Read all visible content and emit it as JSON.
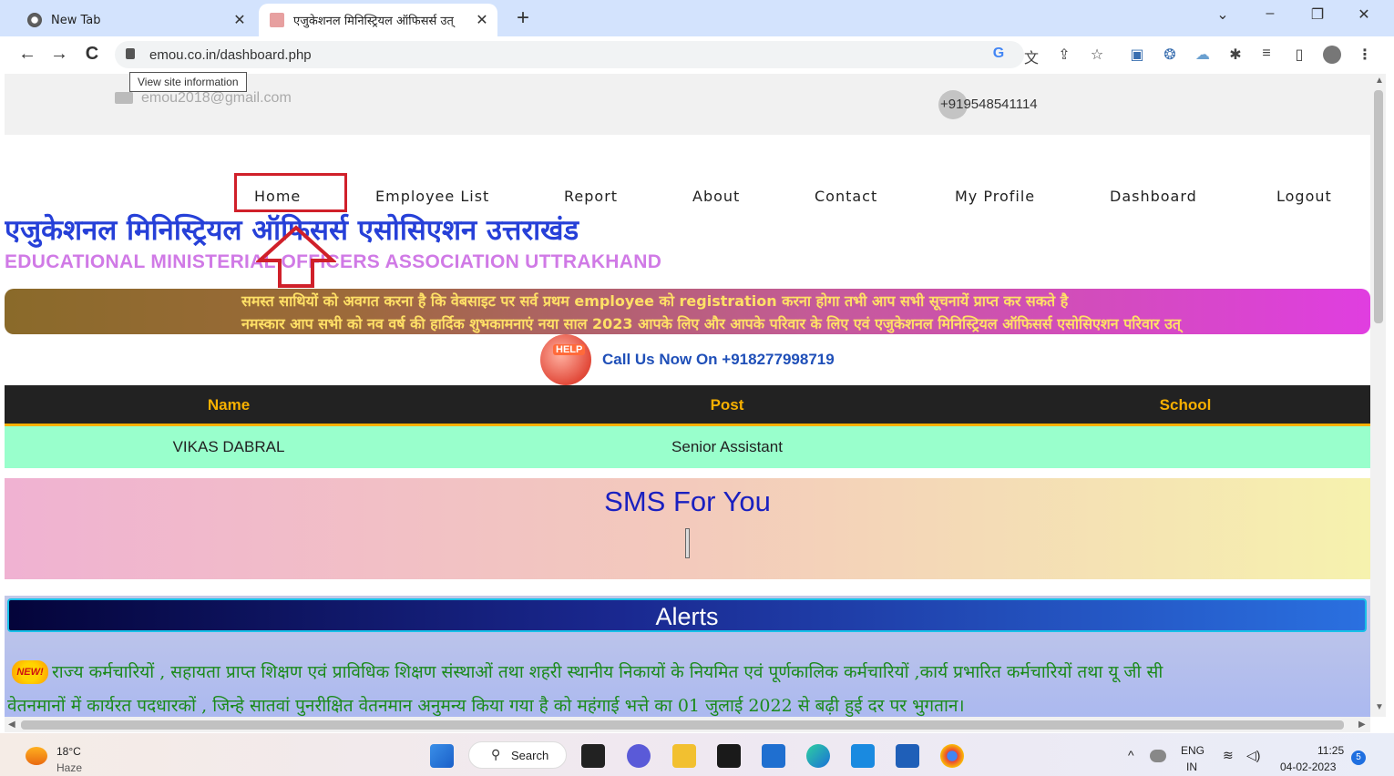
{
  "browser": {
    "tabs": [
      {
        "label": "New Tab",
        "active": false
      },
      {
        "label": "एजुकेशनल मिनिस्ट्रियल ऑफिसर्स उत्",
        "active": true
      }
    ],
    "new_tab": "+",
    "window_controls": {
      "dropdown": "⌄",
      "minimize": "–",
      "restore": "❐",
      "close": "✕"
    },
    "nav": {
      "back": "←",
      "forward": "→",
      "reload": "C"
    },
    "url": "emou.co.in/dashboard.php",
    "tooltip": "View site information",
    "toolbar_icons": [
      "google-icon",
      "translate-icon",
      "share-icon",
      "bookmark-star-icon",
      "extension-image-icon",
      "extension-feather-icon",
      "extension-cloud-icon",
      "extensions-puzzle-icon",
      "reading-list-icon",
      "side-panel-icon",
      "profile-avatar-icon",
      "menu-kebab-icon"
    ]
  },
  "site": {
    "email": "emou2018@gmail.com",
    "phone": "+919548541114",
    "nav": [
      "Home",
      "Employee List",
      "Report",
      "About",
      "Contact",
      "My Profile",
      "Dashboard",
      "Logout"
    ],
    "title_hindi": "एजुकेशनल मिनिस्ट्रियल ऑफिसर्स एसोसिएशन उत्तराखंड",
    "title_english": "EDUCATIONAL MINISTERIAL OFFICERS ASSOCIATION UTTRAKHAND",
    "marquee": [
      "समस्त साथियों को अवगत करना है कि वेबसाइट पर सर्व प्रथम employee को registration करना होगा तभी आप सभी सूचनायें प्राप्त कर सकते है",
      "नमस्कार आप सभी को नव वर्ष की हार्दिक शुभकामनाएं नया साल 2023 आपके लिए और आपके परिवार के लिए एवं एजुकेशनल मिनिस्ट्रियल ऑफिसर्स एसोसिएशन परिवार उत्"
    ],
    "help_badge": "HELP",
    "call_us": "Call Us Now On +918277998719",
    "table": {
      "headers": [
        "Name",
        "Post",
        "School"
      ],
      "rows": [
        [
          "VIKAS DABRAL",
          "Senior Assistant",
          ""
        ]
      ]
    },
    "sms_title": "SMS For You",
    "alerts_title": "Alerts",
    "new_badge": "NEW!",
    "alert_lines": [
      "राज्य कर्मचारियों , सहायता प्राप्त शिक्षण एवं प्राविधिक शिक्षण संस्थाओं तथा शहरी स्थानीय निकायों के नियमित एवं पूर्णकालिक कर्मचारियों ,कार्य प्रभारित कर्मचारियों तथा यू जी सी",
      "वेतनमानों में कार्यरत पदधारकों , जिन्हे सातवां पुनरीक्षित वेतनमान अनुमन्य किया गया है को महंगाई भत्ते का 01 जुलाई 2022 से बढ़ी हुई दर पर भुगतान।"
    ]
  },
  "taskbar": {
    "temperature": "18°C",
    "weather": "Haze",
    "search_label": "Search",
    "language": "ENG",
    "region": "IN",
    "time": "11:25",
    "date": "04-02-2023",
    "notifications": "5",
    "apps": [
      "windows-start-icon",
      "file-explorer-icon",
      "teams-chat-icon",
      "folder-icon",
      "creative-cloud-icon",
      "microsoft-store-icon",
      "edge-icon",
      "outlook-icon",
      "word-icon",
      "chrome-icon"
    ]
  },
  "colors": {
    "browser_tabbar": "#d3e3fd",
    "title_blue": "#2640d8",
    "title_pink": "#d07ae6",
    "marquee_text": "#ffe066",
    "table_header_bg": "#222222",
    "table_header_text": "#f7b000",
    "table_row_bg": "#99ffcc",
    "sms_title": "#1a20c0",
    "alert_text": "#1b8a1b",
    "highlight_red": "#d0202a"
  }
}
